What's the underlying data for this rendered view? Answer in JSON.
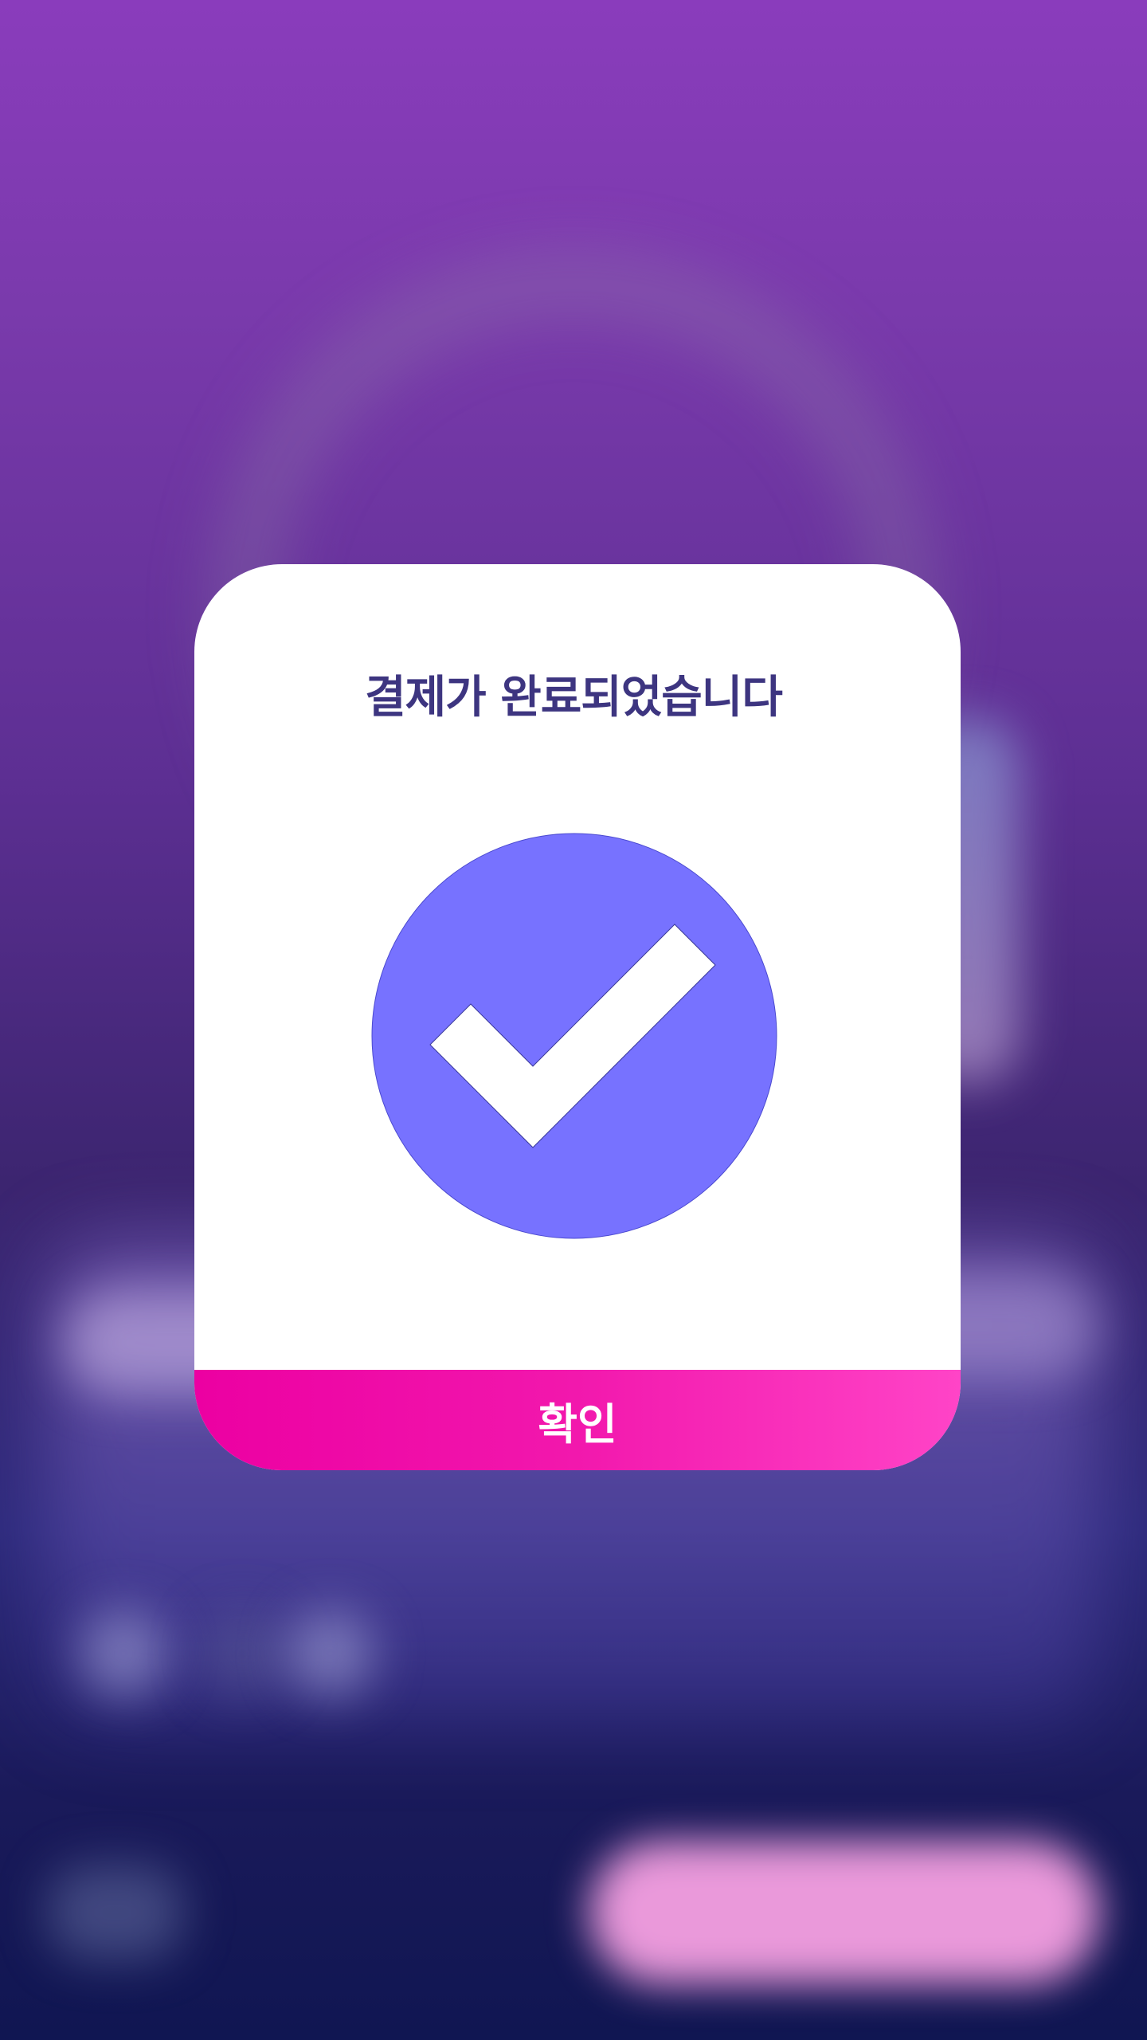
{
  "dialog": {
    "title": "결제가 완료되었습니다",
    "icon": "check-circle-icon",
    "confirm_label": "확인"
  },
  "colors": {
    "title": "#3d3580",
    "check_circle": "#7772ff",
    "button_gradient_start": "#ec00a2",
    "button_gradient_end": "#ff44c7",
    "dialog_background": "#ffffff"
  }
}
